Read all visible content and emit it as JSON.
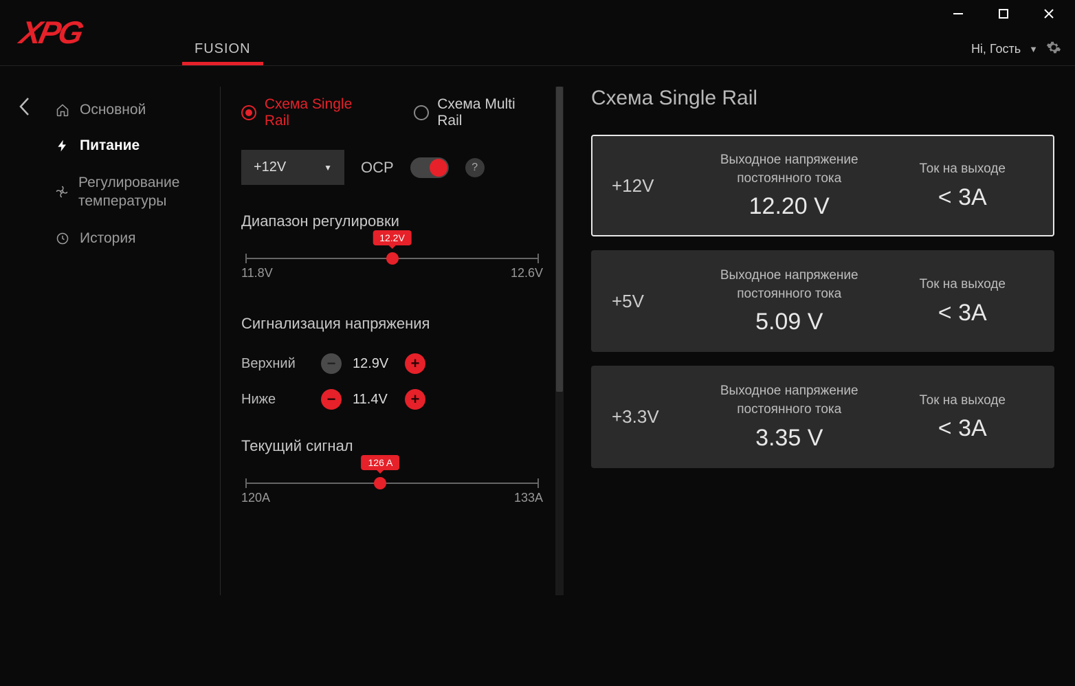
{
  "brand": "XPG",
  "tabs": {
    "fusion": "FUSION"
  },
  "user": {
    "greeting": "Hi, Гость"
  },
  "sidebar": {
    "back": "‹",
    "items": [
      {
        "label": "Основной"
      },
      {
        "label": "Питание"
      },
      {
        "label": "Регулирование температуры"
      },
      {
        "label": "История"
      }
    ]
  },
  "rail_mode": {
    "single": "Схема Single Rail",
    "multi": "Схема Multi Rail"
  },
  "controls": {
    "rail_select": "+12V",
    "ocp_label": "OCP",
    "help": "?"
  },
  "adjust_range": {
    "title": "Диапазон регулировки",
    "min": "11.8V",
    "max": "12.6V",
    "value": "12.2V",
    "pos_pct": 50
  },
  "voltage_alarm": {
    "title": "Сигнализация напряжения",
    "upper_label": "Верхний",
    "upper_value": "12.9V",
    "lower_label": "Ниже",
    "lower_value": "11.4V"
  },
  "current_signal": {
    "title": "Текущий сигнал",
    "min": "120A",
    "max": "133A",
    "value": "126 A",
    "pos_pct": 46
  },
  "right": {
    "title": "Схема Single Rail",
    "voltage_label": "Выходное напряжение постоянного тока",
    "current_label": "Ток на выходе",
    "rails": [
      {
        "name": "+12V",
        "voltage": "12.20 V",
        "current": "< 3A"
      },
      {
        "name": "+5V",
        "voltage": "5.09 V",
        "current": "< 3A"
      },
      {
        "name": "+3.3V",
        "voltage": "3.35 V",
        "current": "< 3A"
      }
    ]
  }
}
